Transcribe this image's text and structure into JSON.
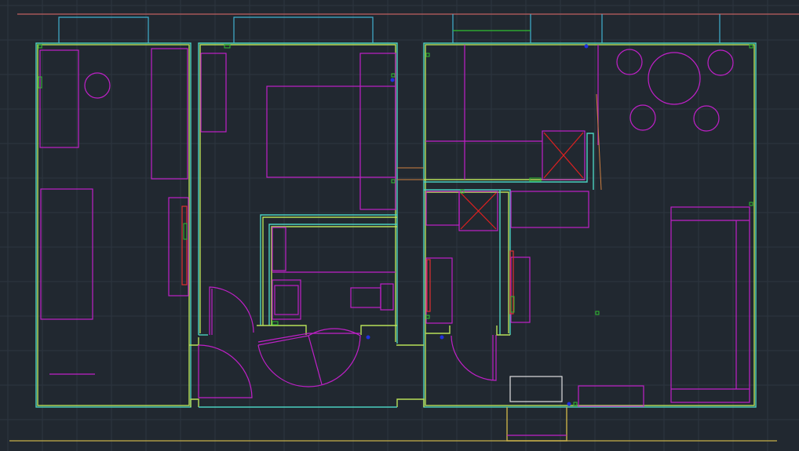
{
  "title": "",
  "colors": {
    "background": "#212830",
    "grid": "#2d3640",
    "wall_outer": "#4bd0c0",
    "wall_inner": "#b8e058",
    "furniture": "#c020c8",
    "appliance_cross": "#e02020",
    "opening_red": "#e03030",
    "guide_top": "#c06060",
    "guide_bottom": "#c8b048",
    "window": "#40b0d0",
    "green_marker": "#30c030",
    "blue_marker": "#2030e0",
    "white_rect": "#e0e0e0",
    "orange_line": "#d08040"
  },
  "layers": [
    "walls",
    "furniture",
    "doors",
    "windows",
    "fixtures",
    "grid"
  ]
}
